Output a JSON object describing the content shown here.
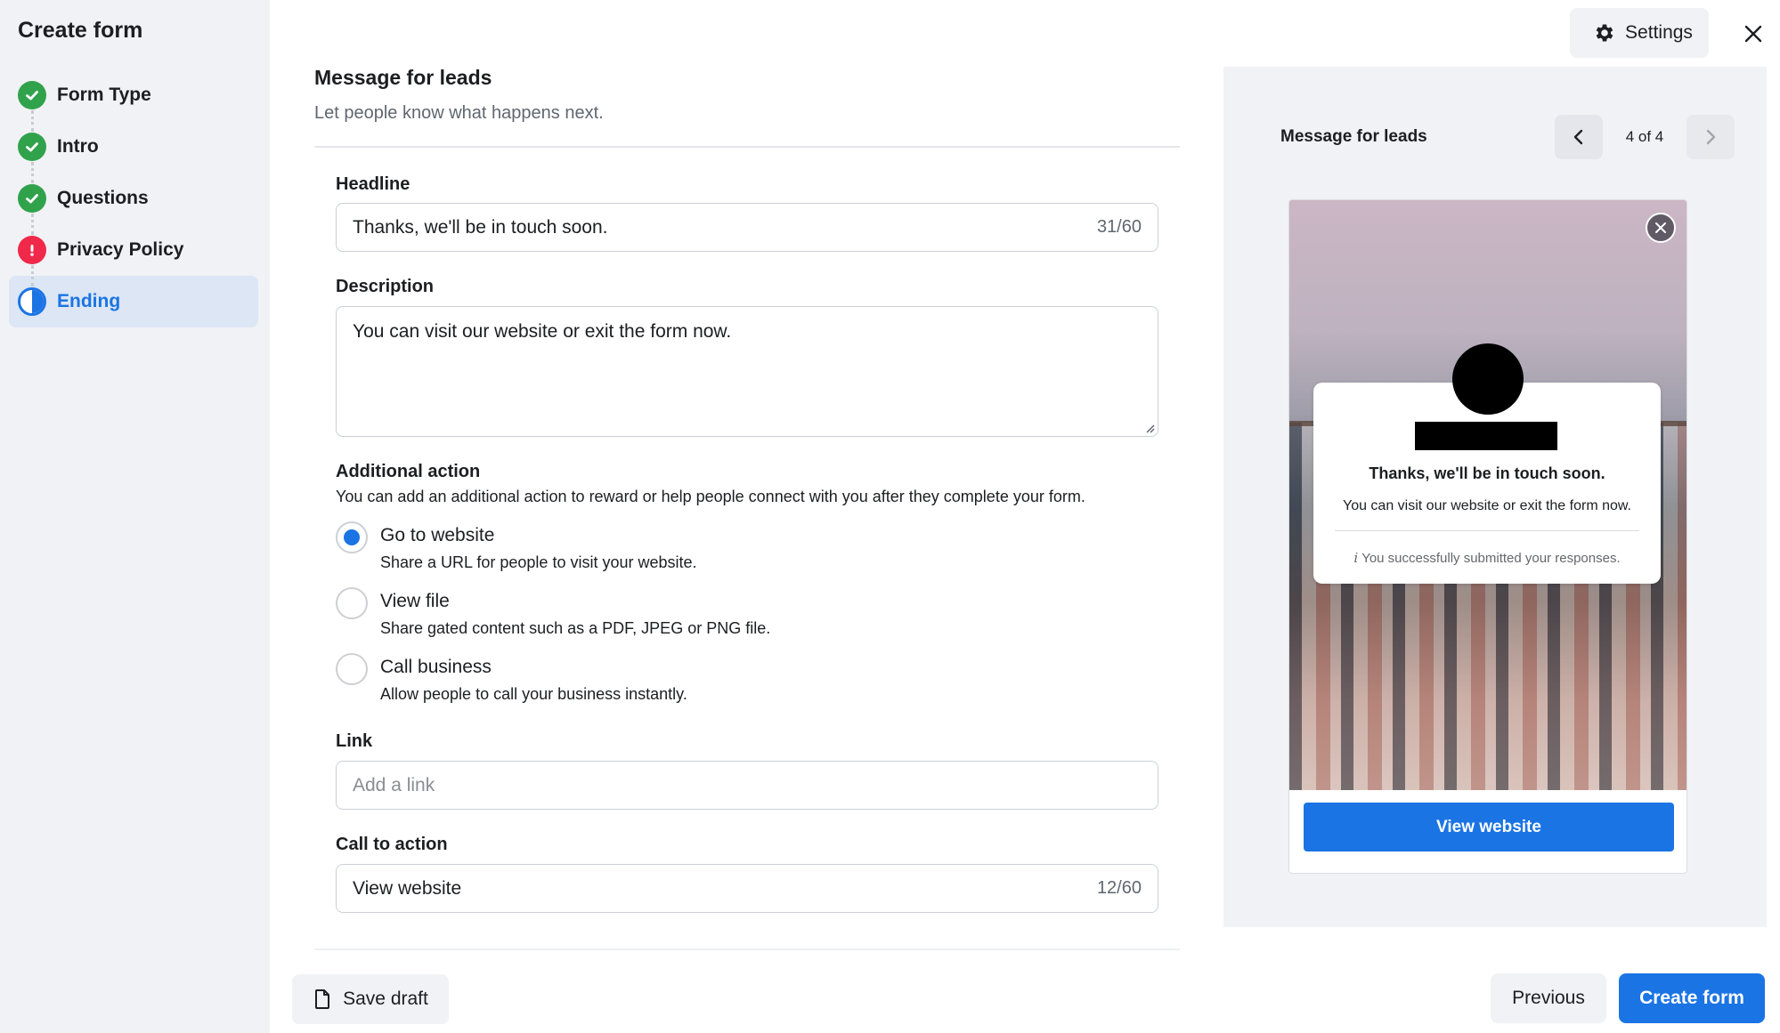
{
  "sidebar": {
    "title": "Create form",
    "steps": [
      {
        "label": "Form Type",
        "status": "done",
        "icon": "check-icon"
      },
      {
        "label": "Intro",
        "status": "done",
        "icon": "check-icon"
      },
      {
        "label": "Questions",
        "status": "done",
        "icon": "check-icon"
      },
      {
        "label": "Privacy Policy",
        "status": "error",
        "icon": "exclamation-icon"
      },
      {
        "label": "Ending",
        "status": "current",
        "icon": "half-circle-icon"
      }
    ]
  },
  "header": {
    "settings_label": "Settings"
  },
  "section": {
    "title": "Message for leads",
    "subtitle": "Let people know what happens next."
  },
  "form": {
    "headline_label": "Headline",
    "headline_value": "Thanks, we'll be in touch soon.",
    "headline_count": "31/60",
    "description_label": "Description",
    "description_value": "You can visit our website or exit the form now.",
    "additional_action_label": "Additional action",
    "additional_action_help": "You can add an additional action to reward or help people connect with you after they complete your form.",
    "options": [
      {
        "title": "Go to website",
        "desc": "Share a URL for people to visit your website.",
        "selected": true
      },
      {
        "title": "View file",
        "desc": "Share gated content such as a PDF, JPEG or PNG file.",
        "selected": false
      },
      {
        "title": "Call business",
        "desc": "Allow people to call your business instantly.",
        "selected": false
      }
    ],
    "link_label": "Link",
    "link_placeholder": "Add a link",
    "cta_label": "Call to action",
    "cta_value": "View website",
    "cta_count": "12/60"
  },
  "preview": {
    "title": "Message for leads",
    "pager": "4 of 4",
    "headline": "Thanks, we'll be in touch soon.",
    "description": "You can visit our website or exit the form now.",
    "note_icon": "i",
    "note": "You successfully submitted your responses.",
    "button": "View website"
  },
  "footer": {
    "save_label": "Save draft",
    "previous_label": "Previous",
    "create_label": "Create form"
  },
  "colors": {
    "accent": "#1b74e4",
    "success": "#31a24c",
    "error": "#f02849"
  }
}
